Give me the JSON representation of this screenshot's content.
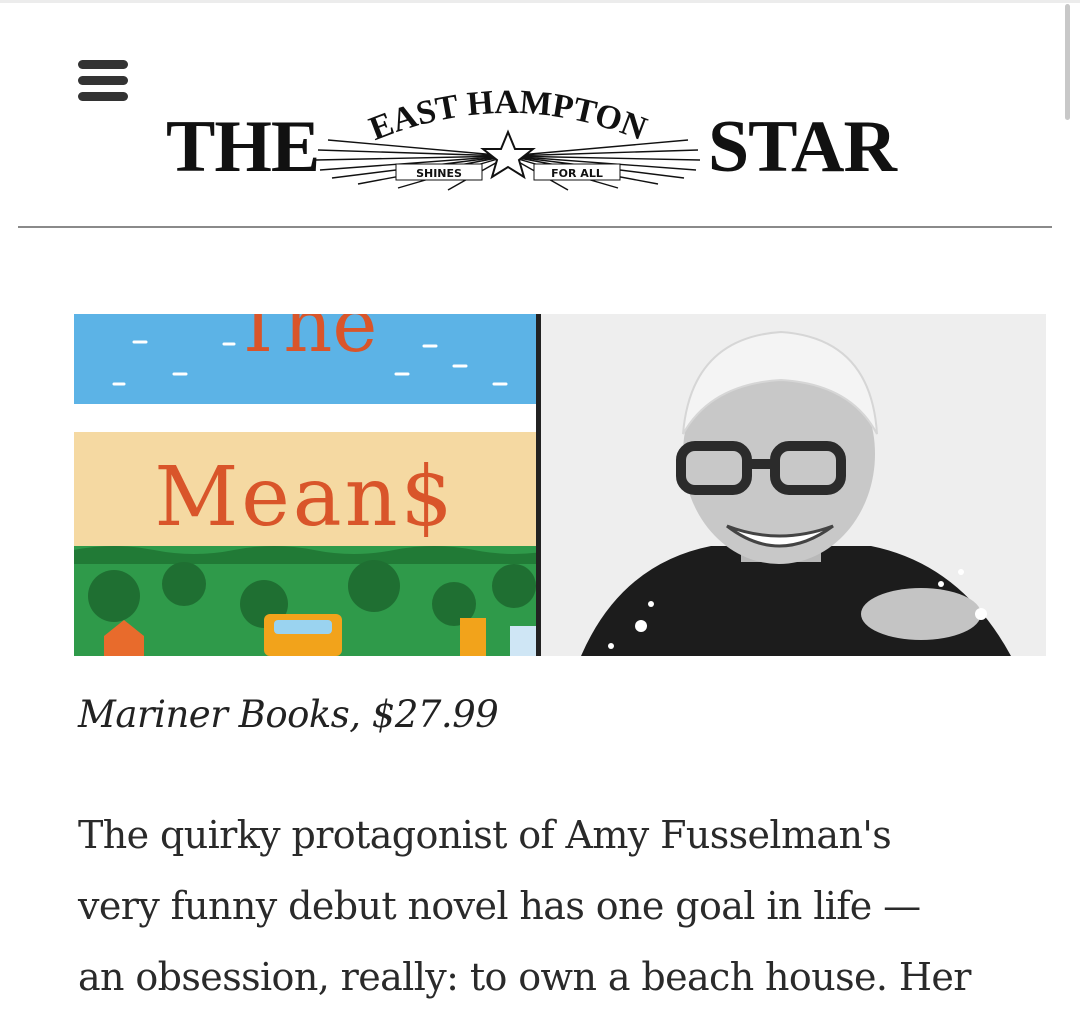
{
  "header": {
    "menu_icon": "hamburger-menu-icon",
    "masthead": {
      "word_left": "THE",
      "arc_text": "EAST HAMPTON",
      "tagline_left": "SHINES",
      "tagline_right": "FOR ALL",
      "word_right": "STAR"
    }
  },
  "article": {
    "hero": {
      "book_title_line1": "The",
      "book_title_line2": "Mean$",
      "author_photo_icon": "author-portrait"
    },
    "caption": "Mariner Books, $27.99",
    "body_lines": [
      "The quirky protagonist of Amy Fusselman's",
      "very funny debut novel has one goal in life —",
      "an obsession, really: to own a beach house. Her"
    ]
  },
  "colors": {
    "cover_title": "#d9552a",
    "cover_sky": "#5cb3e6",
    "cover_sand": "#f5d9a2",
    "cover_grass": "#2f9a4a",
    "text": "#222222"
  }
}
